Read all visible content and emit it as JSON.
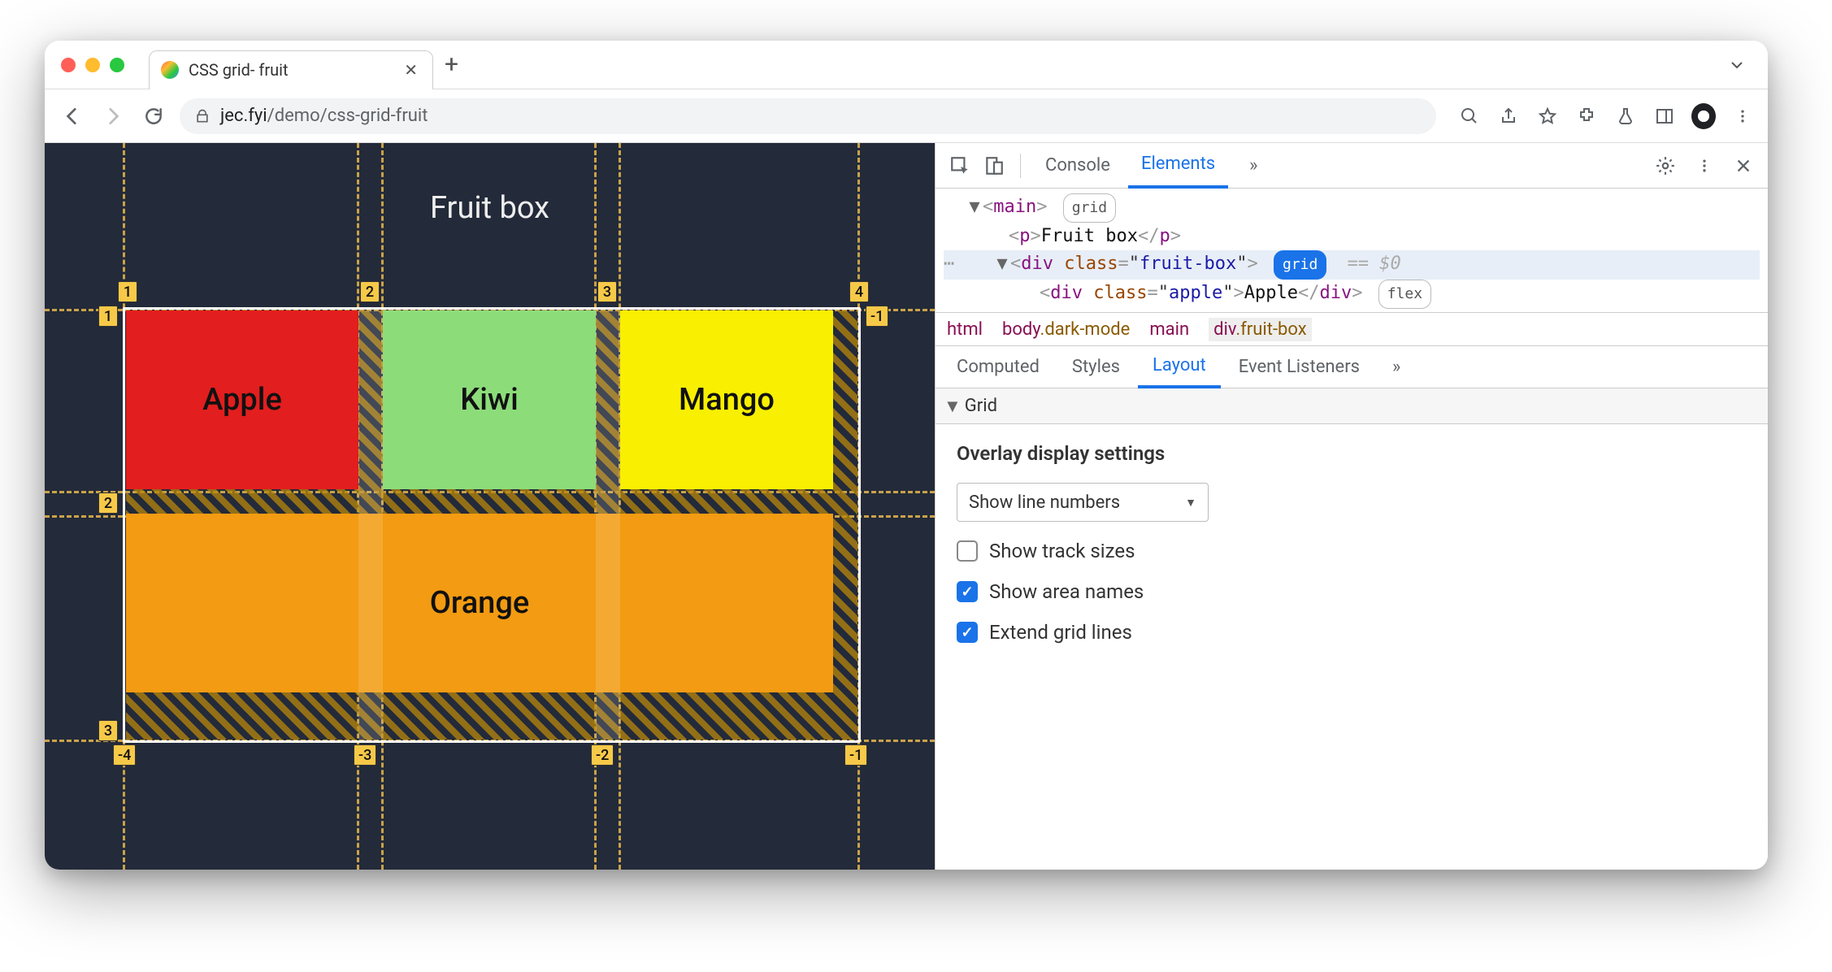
{
  "tab": {
    "title": "CSS grid- fruit"
  },
  "url": {
    "domain": "jec.fyi",
    "path": "/demo/css-grid-fruit"
  },
  "page": {
    "title": "Fruit box",
    "cells": {
      "apple": "Apple",
      "kiwi": "Kiwi",
      "mango": "Mango",
      "orange": "Orange"
    },
    "grid_overlay": {
      "columns_top": [
        "1",
        "2",
        "3",
        "4"
      ],
      "rows_left": [
        "1",
        "2",
        "3"
      ],
      "right_neg": "-1",
      "bottom_neg": [
        "-4",
        "-3",
        "-2",
        "-1"
      ]
    }
  },
  "devtools": {
    "tabs": {
      "console": "Console",
      "elements": "Elements",
      "more": "»"
    },
    "dom": {
      "main_tag": "main",
      "main_badge": "grid",
      "p_text": "Fruit box",
      "div_class": "fruit-box",
      "div_badge": "grid",
      "eq0": "== $0",
      "child_class": "apple",
      "child_text": "Apple",
      "child_badge": "flex"
    },
    "breadcrumbs": {
      "html": "html",
      "body": "body",
      "body_class": ".dark-mode",
      "main": "main",
      "div": "div",
      "div_class": ".fruit-box"
    },
    "sub_tabs": {
      "computed": "Computed",
      "styles": "Styles",
      "layout": "Layout",
      "listeners": "Event Listeners",
      "more": "»"
    },
    "grid_section": "Grid",
    "layout": {
      "heading": "Overlay display settings",
      "select": "Show line numbers",
      "checkboxes": {
        "track_sizes": {
          "label": "Show track sizes",
          "checked": false
        },
        "area_names": {
          "label": "Show area names",
          "checked": true
        },
        "extend_lines": {
          "label": "Extend grid lines",
          "checked": true
        }
      }
    }
  }
}
